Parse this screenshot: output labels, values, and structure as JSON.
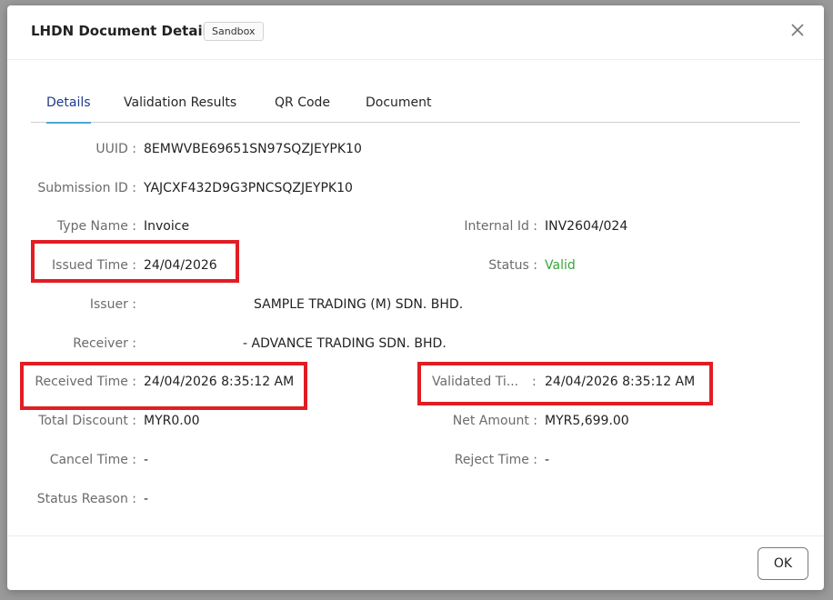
{
  "modal": {
    "title": "LHDN Document Details",
    "badge": "Sandbox",
    "close_icon": "close-icon",
    "ok_label": "OK"
  },
  "tabs": [
    {
      "label": "Details",
      "active": true
    },
    {
      "label": "Validation Results",
      "active": false
    },
    {
      "label": "QR Code",
      "active": false
    },
    {
      "label": "Document",
      "active": false
    }
  ],
  "details": {
    "uuid_label": "UUID :",
    "uuid": "8EMWVBE69651SN97SQZJEYPK10",
    "submission_label": "Submission ID :",
    "submission": "YAJCXF432D9G3PNCSQZJEYPK10",
    "type_label": "Type Name :",
    "type": "Invoice",
    "internal_label": "Internal Id :",
    "internal": "INV2604/024",
    "issued_label": "Issued Time :",
    "issued": "24/04/2026",
    "status_label": "Status :",
    "status": "Valid",
    "issuer_label": "Issuer :",
    "issuer": "SAMPLE TRADING (M) SDN. BHD.",
    "receiver_label": "Receiver :",
    "receiver": "- ADVANCE TRADING SDN. BHD.",
    "received_label": "Received Time :",
    "received": "24/04/2026 8:35:12 AM",
    "validated_label": "Validated Ti...",
    "validated_colon": ":",
    "validated": "24/04/2026 8:35:12 AM",
    "discount_label": "Total Discount :",
    "discount": "MYR0.00",
    "net_label": "Net Amount :",
    "net": "MYR5,699.00",
    "cancel_label": "Cancel Time :",
    "cancel": "-",
    "reject_label": "Reject Time :",
    "reject": "-",
    "reason_label": "Status Reason :",
    "reason": "-"
  },
  "colors": {
    "highlight": "#e11d24",
    "valid": "#3aa33a",
    "tab_active": "#1e3a8a",
    "tab_underline": "#4aa8d8"
  }
}
